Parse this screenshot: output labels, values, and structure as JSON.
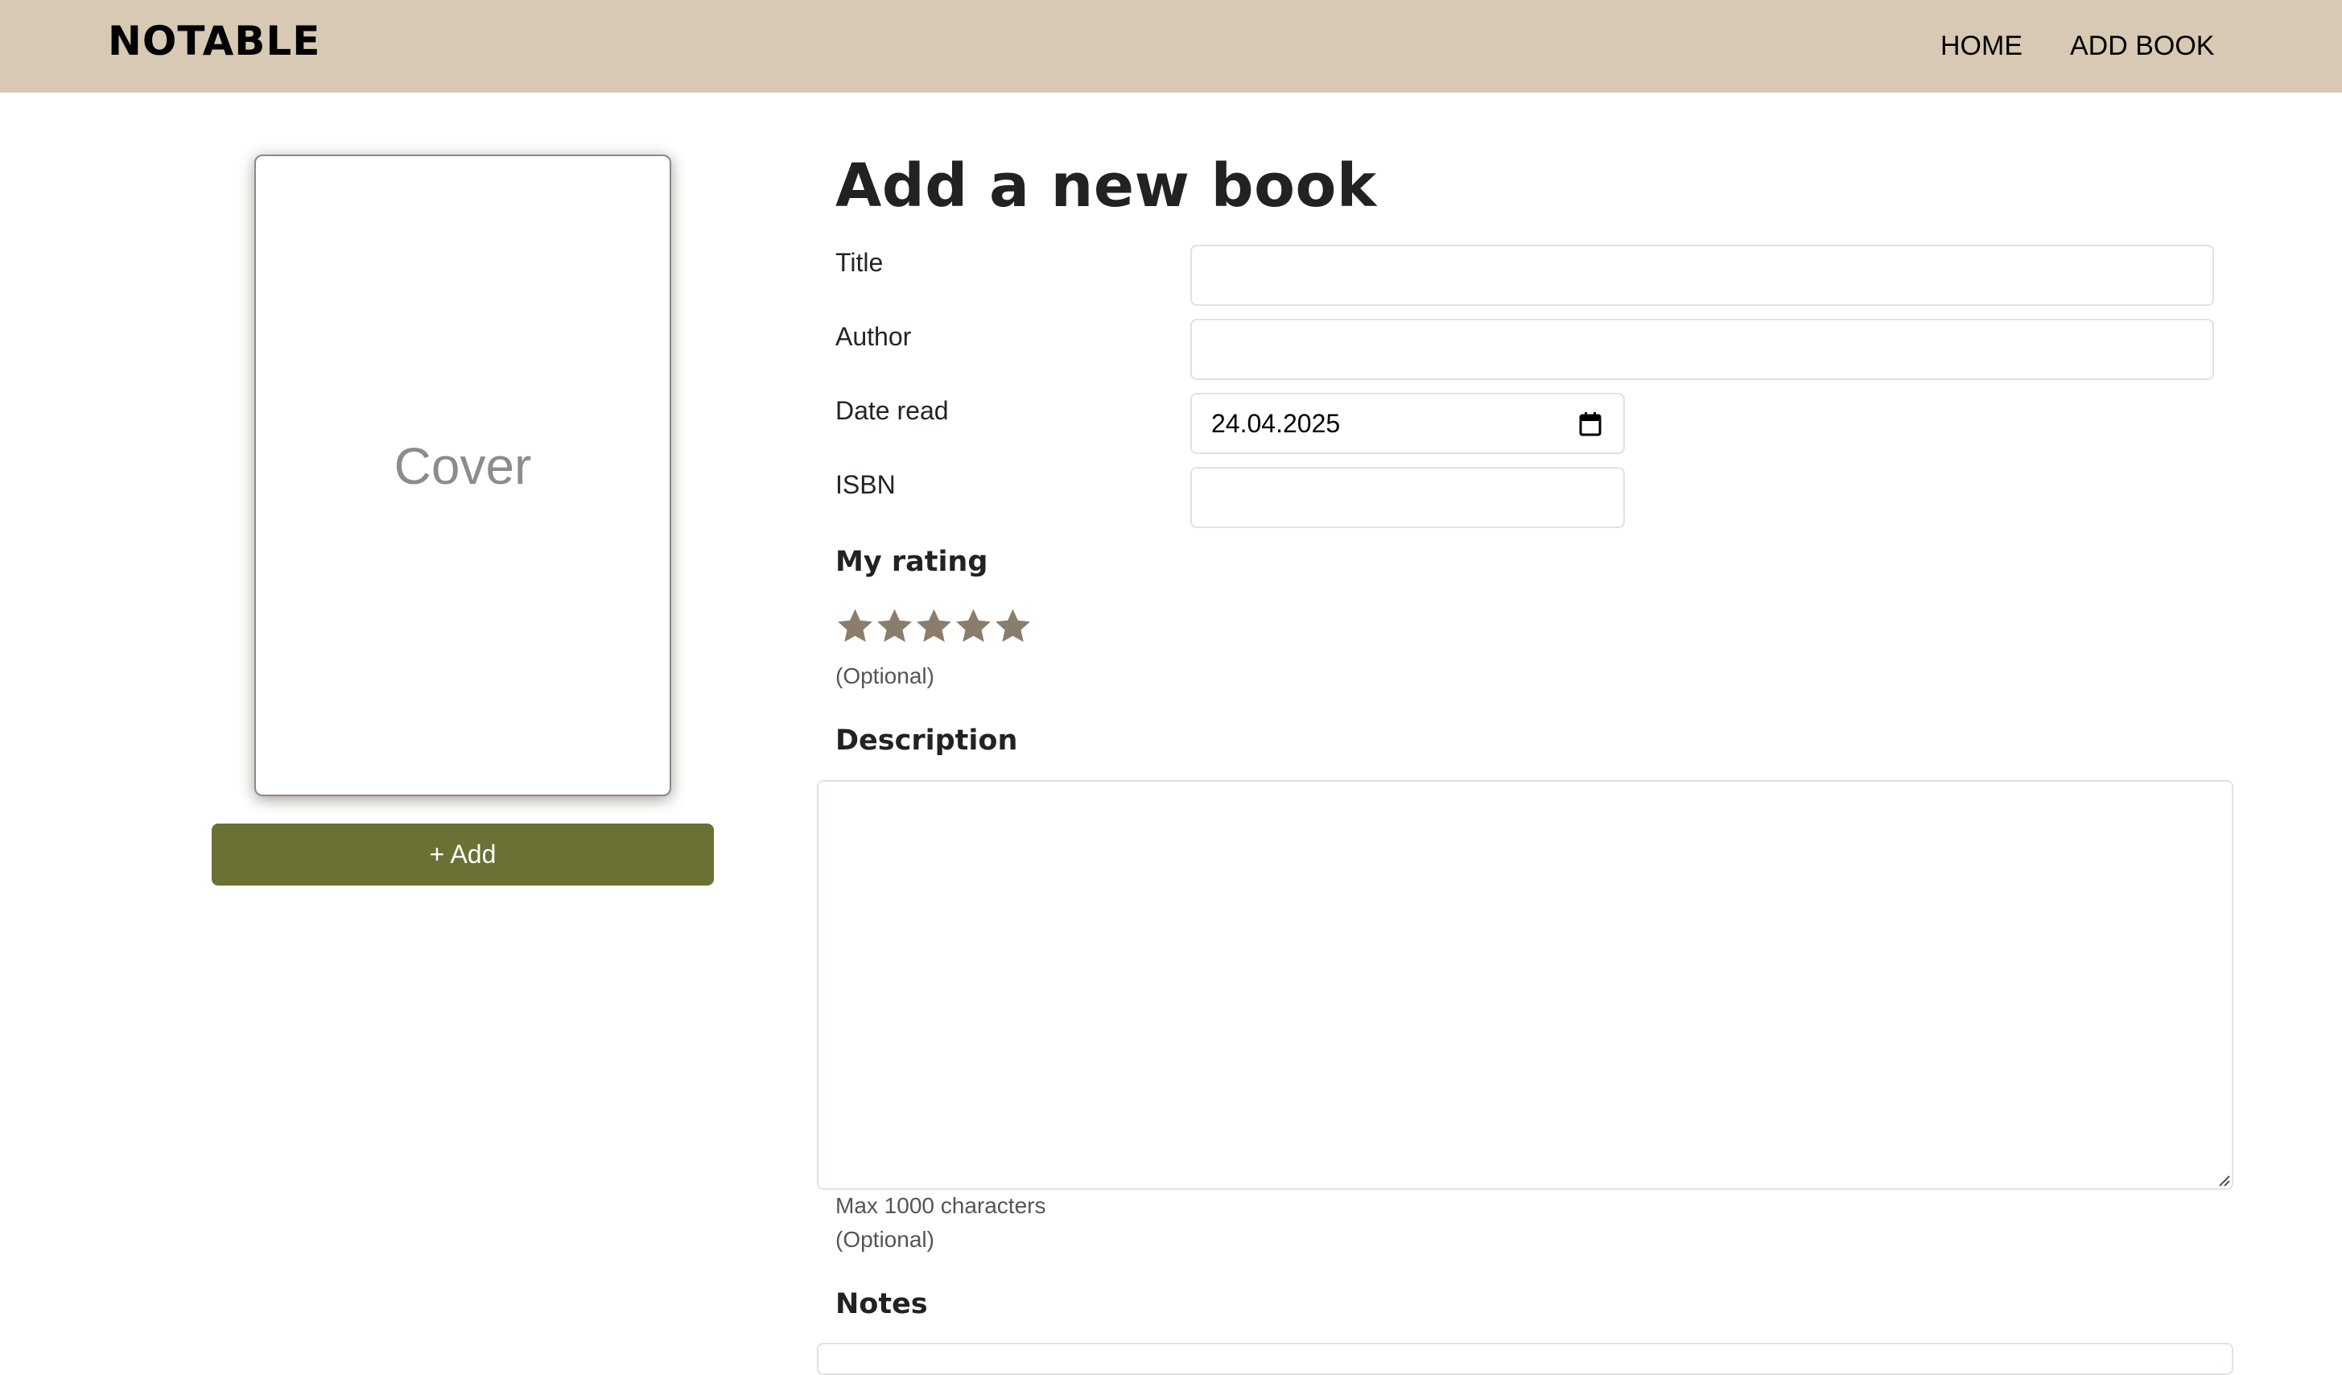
{
  "navbar": {
    "brand": "NOTABLE",
    "links": [
      {
        "label": "HOME"
      },
      {
        "label": "ADD BOOK"
      }
    ]
  },
  "cover": {
    "placeholder": "Cover",
    "add_button": "+ Add"
  },
  "form": {
    "title": "Add a new book",
    "fields": {
      "title": {
        "label": "Title",
        "value": ""
      },
      "author": {
        "label": "Author",
        "value": ""
      },
      "date_read": {
        "label": "Date read",
        "value": "24.04.2025"
      },
      "isbn": {
        "label": "ISBN",
        "value": ""
      }
    },
    "rating": {
      "heading": "My rating",
      "max_stars": 5,
      "selected": 0,
      "hint": "(Optional)"
    },
    "description": {
      "heading": "Description",
      "value": "",
      "max_hint": "Max 1000 characters",
      "optional_hint": "(Optional)"
    },
    "notes": {
      "heading": "Notes"
    }
  },
  "colors": {
    "navbar_bg": "#d8c9b4",
    "add_button_bg": "#6b7035",
    "star_color": "#8b7d6b",
    "cover_text": "#8c8c8c"
  },
  "icons": {
    "date_picker": "calendar-icon",
    "rating": "star-icon"
  }
}
